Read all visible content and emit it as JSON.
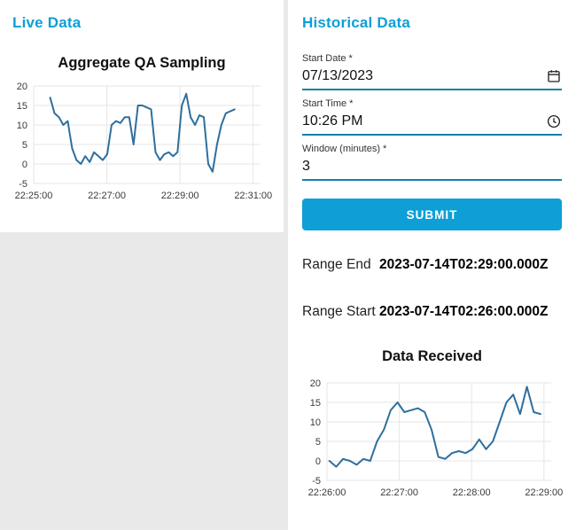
{
  "colors": {
    "accent": "#0d9fd6",
    "underline": "#0e81ad",
    "chart_line": "#2e6f9e",
    "chart_grid": "#e6e6e6",
    "chart_tick_text": "#3a3a3a"
  },
  "live_panel": {
    "title": "Live Data"
  },
  "historical_panel": {
    "title": "Historical Data",
    "form": {
      "start_date": {
        "label": "Start Date",
        "required_mark": "*",
        "value": "07/13/2023",
        "icon": "calendar-icon"
      },
      "start_time": {
        "label": "Start Time",
        "required_mark": "*",
        "value": "10:26 PM",
        "icon": "clock-icon"
      },
      "window_minutes": {
        "label": "Window (minutes)",
        "required_mark": "*",
        "value": "3"
      }
    },
    "submit_label": "SUBMIT",
    "range_end": {
      "label": "Range End",
      "value": "2023-07-14T02:29:00.000Z"
    },
    "range_start": {
      "label": "Range Start",
      "value": "2023-07-14T02:26:00.000Z"
    }
  },
  "chart_data": [
    {
      "type": "line",
      "title": "Aggregate QA Sampling",
      "xlabel": "",
      "ylabel": "",
      "x_unit": "seconds after 22:25:00",
      "x_domain": [
        0,
        372
      ],
      "y_domain": [
        -5,
        20
      ],
      "y_ticks": [
        20,
        15,
        10,
        5,
        0,
        -5
      ],
      "x_ticks": [
        {
          "pos": 0,
          "label": "22:25:00"
        },
        {
          "pos": 120,
          "label": "22:27:00"
        },
        {
          "pos": 240,
          "label": "22:29:00"
        },
        {
          "pos": 360,
          "label": "22:31:00"
        }
      ],
      "grid": true,
      "legend": false,
      "series": {
        "name": "Aggregate QA Sampling",
        "x_start": 27,
        "x_step": 7.2,
        "y": [
          17,
          13,
          12,
          10,
          11,
          4,
          1,
          0,
          2,
          0.5,
          3,
          2,
          1,
          2.5,
          10,
          11,
          10.5,
          12,
          12,
          5,
          15,
          15,
          14.5,
          14,
          3,
          1,
          2.5,
          3,
          2,
          3,
          15,
          18,
          12,
          10,
          12.5,
          12,
          0,
          -2,
          5,
          10,
          13,
          13.5,
          14
        ]
      }
    },
    {
      "type": "line",
      "title": "Data Received",
      "xlabel": "",
      "ylabel": "",
      "x_unit": "seconds after 22:26:00",
      "x_domain": [
        0,
        186
      ],
      "y_domain": [
        -5,
        20
      ],
      "y_ticks": [
        20,
        15,
        10,
        5,
        0,
        -5
      ],
      "x_ticks": [
        {
          "pos": 0,
          "label": "22:26:00"
        },
        {
          "pos": 60,
          "label": "22:27:00"
        },
        {
          "pos": 120,
          "label": "22:28:00"
        },
        {
          "pos": 180,
          "label": "22:29:00"
        }
      ],
      "grid": true,
      "legend": false,
      "series": {
        "name": "Data Received",
        "x_start": 2,
        "x_step": 5.65,
        "y": [
          0,
          -1.5,
          0.5,
          0,
          -1,
          0.5,
          0,
          5,
          8,
          13,
          15,
          12.5,
          13,
          13.5,
          12.5,
          8,
          1,
          0.5,
          2,
          2.5,
          2,
          3,
          5.5,
          3,
          5,
          10,
          15,
          17,
          12,
          19,
          12.5,
          12
        ]
      }
    }
  ]
}
